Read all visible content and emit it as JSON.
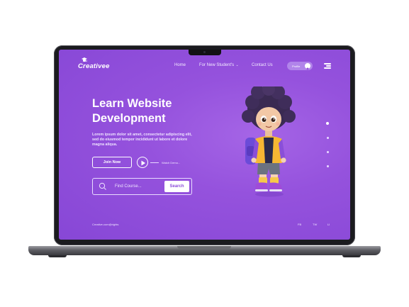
{
  "brand": {
    "name": "Creativee",
    "logo_icon": "graduation-cap-icon"
  },
  "nav": {
    "links": [
      {
        "label": "Home"
      },
      {
        "label": "For New Student's"
      },
      {
        "label": "Contact Us"
      }
    ],
    "students_caret": "chevron-down-icon",
    "profile_label": "Profile",
    "menu_icon": "hamburger-menu-icon"
  },
  "hero": {
    "title_line1": "Learn Website",
    "title_line2": "Development",
    "description": "Lorem ipsum dolor sit amet, consectetur adipiscing elit, sed do eiusmod tempor incididunt ut labore et dolore magna aliqua.",
    "join_label": "Join Now",
    "watch_label": "Watch Demo...",
    "search_placeholder": "Find Course...",
    "search_button": "Search"
  },
  "slider": {
    "dots": 4,
    "active_index": 0
  },
  "footer": {
    "copyright": "Creative.com@rights",
    "social": [
      "FB",
      "TW",
      "LI"
    ]
  },
  "colors": {
    "accent_purple": "#9552dd",
    "text_white": "#ffffff",
    "frame_dark": "#1b1b1f"
  }
}
